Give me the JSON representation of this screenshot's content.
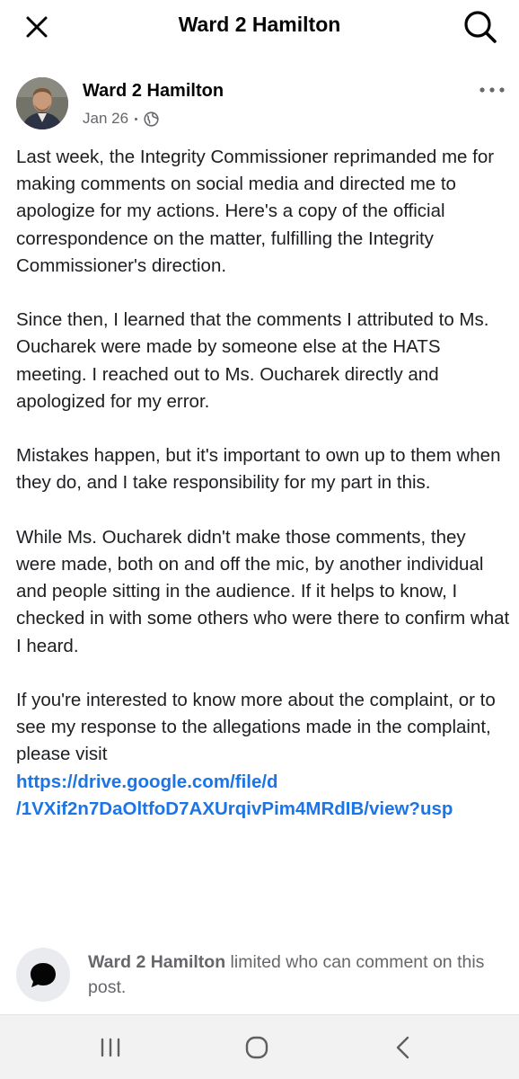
{
  "header": {
    "title": "Ward 2 Hamilton",
    "close_icon": "close-icon",
    "search_icon": "search-icon"
  },
  "post": {
    "author": "Ward 2 Hamilton",
    "date": "Jan 26",
    "privacy_icon": "globe-icon",
    "more_icon": "more-options-icon",
    "paragraphs": [
      "Last week, the Integrity Commissioner reprimanded me for making comments on social media and directed me to apologize for my actions. Here's a copy of the official correspondence on the matter, fulfilling the Integrity Commissioner's direction.",
      "Since then, I learned that the comments I attributed to Ms. Oucharek were made by someone else at the HATS meeting. I reached out to Ms. Oucharek directly and apologized for my error.",
      "Mistakes happen, but it's important to own up to them when they do, and I take responsibility for my part in this.",
      "While Ms. Oucharek didn't make those comments, they were made, both on and off the mic, by another individual and people sitting in the audience. If it helps to know, I checked in with some others who were there to confirm what I heard.",
      "If you're interested to know more about the complaint, or to see my response to the allegations made in the complaint, please visit"
    ],
    "link_line1": "https://drive.google.com/file/d",
    "link_line2": "/1VXif2n7DaOltfoD7AXUrqivPim4MRdIB/view?usp"
  },
  "comment_notice": {
    "name": "Ward 2 Hamilton",
    "text": " limited who can comment on this post.",
    "icon": "speech-bubble-icon"
  },
  "system_nav": {
    "recent_icon": "recent-apps-icon",
    "home_icon": "home-icon",
    "back_icon": "back-icon"
  },
  "colors": {
    "link": "#1d74e4",
    "secondary_text": "#65676b"
  }
}
